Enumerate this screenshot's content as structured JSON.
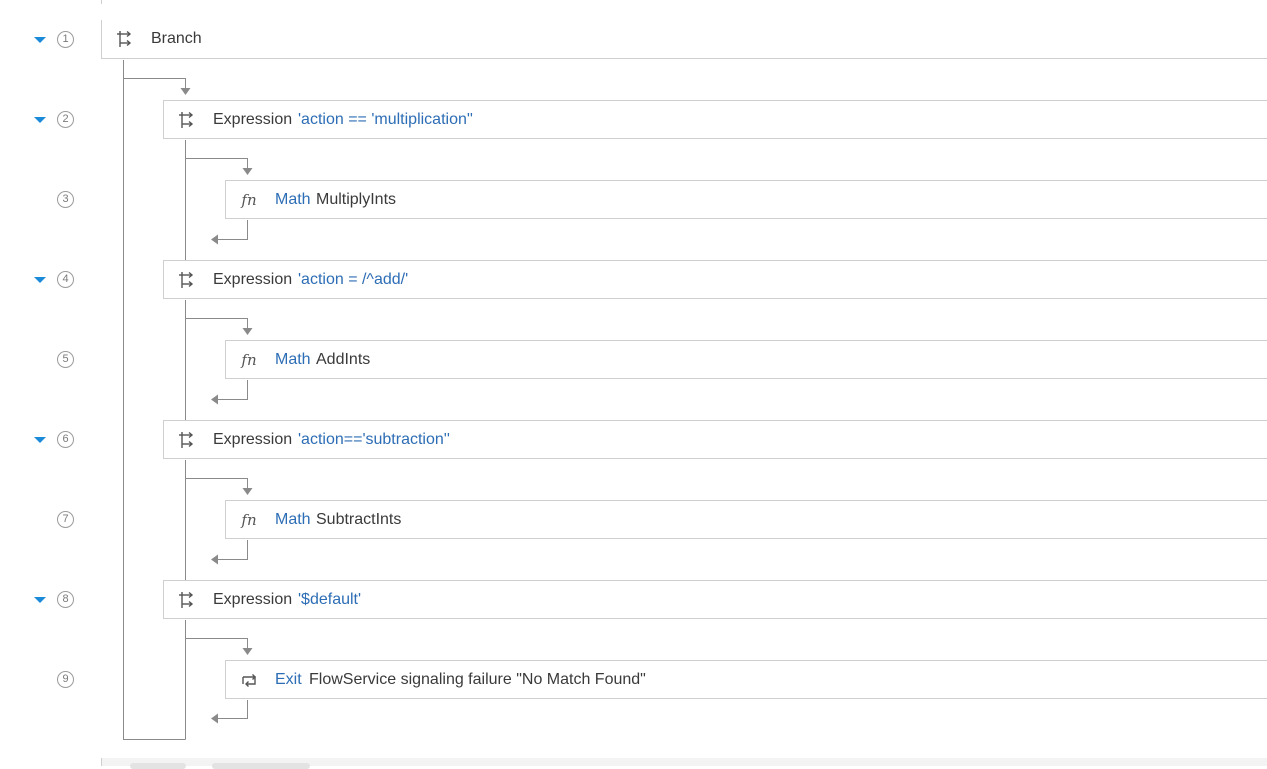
{
  "steps": [
    {
      "number": "1",
      "type": "branch",
      "label": "Branch",
      "collapsible": true
    },
    {
      "number": "2",
      "type": "expression",
      "label": "Expression",
      "value": "'action == 'multiplication''",
      "collapsible": true
    },
    {
      "number": "3",
      "type": "function",
      "keyword": "Math",
      "label": "MultiplyInts",
      "collapsible": false
    },
    {
      "number": "4",
      "type": "expression",
      "label": "Expression",
      "value": "'action = /^add/'",
      "collapsible": true
    },
    {
      "number": "5",
      "type": "function",
      "keyword": "Math",
      "label": "AddInts",
      "collapsible": false
    },
    {
      "number": "6",
      "type": "expression",
      "label": "Expression",
      "value": "'action=='subtraction''",
      "collapsible": true
    },
    {
      "number": "7",
      "type": "function",
      "keyword": "Math",
      "label": "SubtractInts",
      "collapsible": false
    },
    {
      "number": "8",
      "type": "expression",
      "label": "Expression",
      "value": "'$default'",
      "collapsible": true
    },
    {
      "number": "9",
      "type": "exit",
      "keyword": "Exit",
      "label": "FlowService signaling failure \"No Match Found\"",
      "collapsible": false
    }
  ],
  "colors": {
    "accent": "#1a8ad8",
    "keyword": "#2d6db5",
    "connector": "#8a8a8a",
    "border": "#cfcfcf"
  }
}
